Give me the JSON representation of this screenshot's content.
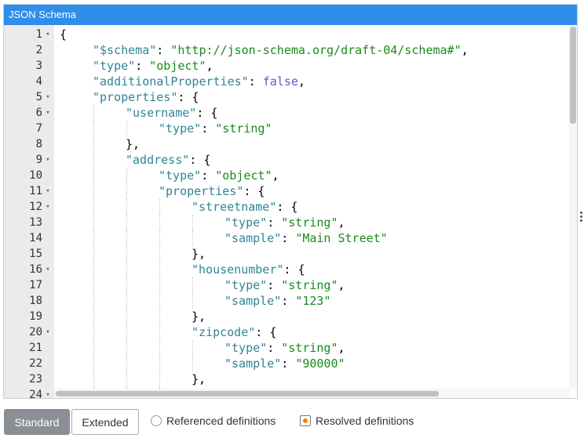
{
  "panel": {
    "title": "JSON Schema"
  },
  "editor": {
    "lines": [
      {
        "n": "1",
        "fold": true,
        "indent": 0,
        "tokens": [
          {
            "t": "{",
            "c": "p"
          }
        ]
      },
      {
        "n": "2",
        "fold": false,
        "indent": 1,
        "tokens": [
          {
            "t": "\"$schema\"",
            "c": "k"
          },
          {
            "t": ": ",
            "c": "p"
          },
          {
            "t": "\"http://json-schema.org/draft-04/schema#\"",
            "c": "s"
          },
          {
            "t": ",",
            "c": "p"
          }
        ]
      },
      {
        "n": "3",
        "fold": false,
        "indent": 1,
        "tokens": [
          {
            "t": "\"type\"",
            "c": "k"
          },
          {
            "t": ": ",
            "c": "p"
          },
          {
            "t": "\"object\"",
            "c": "s"
          },
          {
            "t": ",",
            "c": "p"
          }
        ]
      },
      {
        "n": "4",
        "fold": false,
        "indent": 1,
        "tokens": [
          {
            "t": "\"additionalProperties\"",
            "c": "k"
          },
          {
            "t": ": ",
            "c": "p"
          },
          {
            "t": "false",
            "c": "c"
          },
          {
            "t": ",",
            "c": "p"
          }
        ]
      },
      {
        "n": "5",
        "fold": true,
        "indent": 1,
        "tokens": [
          {
            "t": "\"properties\"",
            "c": "k"
          },
          {
            "t": ": {",
            "c": "p"
          }
        ]
      },
      {
        "n": "6",
        "fold": true,
        "indent": 2,
        "tokens": [
          {
            "t": "\"username\"",
            "c": "k"
          },
          {
            "t": ": {",
            "c": "p"
          }
        ]
      },
      {
        "n": "7",
        "fold": false,
        "indent": 3,
        "tokens": [
          {
            "t": "\"type\"",
            "c": "k"
          },
          {
            "t": ": ",
            "c": "p"
          },
          {
            "t": "\"string\"",
            "c": "s"
          }
        ]
      },
      {
        "n": "8",
        "fold": false,
        "indent": 2,
        "tokens": [
          {
            "t": "},",
            "c": "p"
          }
        ]
      },
      {
        "n": "9",
        "fold": true,
        "indent": 2,
        "tokens": [
          {
            "t": "\"address\"",
            "c": "k"
          },
          {
            "t": ": {",
            "c": "p"
          }
        ]
      },
      {
        "n": "10",
        "fold": false,
        "indent": 3,
        "tokens": [
          {
            "t": "\"type\"",
            "c": "k"
          },
          {
            "t": ": ",
            "c": "p"
          },
          {
            "t": "\"object\"",
            "c": "s"
          },
          {
            "t": ",",
            "c": "p"
          }
        ]
      },
      {
        "n": "11",
        "fold": true,
        "indent": 3,
        "tokens": [
          {
            "t": "\"properties\"",
            "c": "k"
          },
          {
            "t": ": {",
            "c": "p"
          }
        ]
      },
      {
        "n": "12",
        "fold": true,
        "indent": 4,
        "tokens": [
          {
            "t": "\"streetname\"",
            "c": "k"
          },
          {
            "t": ": {",
            "c": "p"
          }
        ]
      },
      {
        "n": "13",
        "fold": false,
        "indent": 5,
        "tokens": [
          {
            "t": "\"type\"",
            "c": "k"
          },
          {
            "t": ": ",
            "c": "p"
          },
          {
            "t": "\"string\"",
            "c": "s"
          },
          {
            "t": ",",
            "c": "p"
          }
        ]
      },
      {
        "n": "14",
        "fold": false,
        "indent": 5,
        "tokens": [
          {
            "t": "\"sample\"",
            "c": "k"
          },
          {
            "t": ": ",
            "c": "p"
          },
          {
            "t": "\"Main Street\"",
            "c": "s"
          }
        ]
      },
      {
        "n": "15",
        "fold": false,
        "indent": 4,
        "tokens": [
          {
            "t": "},",
            "c": "p"
          }
        ]
      },
      {
        "n": "16",
        "fold": true,
        "indent": 4,
        "tokens": [
          {
            "t": "\"housenumber\"",
            "c": "k"
          },
          {
            "t": ": {",
            "c": "p"
          }
        ]
      },
      {
        "n": "17",
        "fold": false,
        "indent": 5,
        "tokens": [
          {
            "t": "\"type\"",
            "c": "k"
          },
          {
            "t": ": ",
            "c": "p"
          },
          {
            "t": "\"string\"",
            "c": "s"
          },
          {
            "t": ",",
            "c": "p"
          }
        ]
      },
      {
        "n": "18",
        "fold": false,
        "indent": 5,
        "tokens": [
          {
            "t": "\"sample\"",
            "c": "k"
          },
          {
            "t": ": ",
            "c": "p"
          },
          {
            "t": "\"123\"",
            "c": "s"
          }
        ]
      },
      {
        "n": "19",
        "fold": false,
        "indent": 4,
        "tokens": [
          {
            "t": "},",
            "c": "p"
          }
        ]
      },
      {
        "n": "20",
        "fold": true,
        "indent": 4,
        "tokens": [
          {
            "t": "\"zipcode\"",
            "c": "k"
          },
          {
            "t": ": {",
            "c": "p"
          }
        ]
      },
      {
        "n": "21",
        "fold": false,
        "indent": 5,
        "tokens": [
          {
            "t": "\"type\"",
            "c": "k"
          },
          {
            "t": ": ",
            "c": "p"
          },
          {
            "t": "\"string\"",
            "c": "s"
          },
          {
            "t": ",",
            "c": "p"
          }
        ]
      },
      {
        "n": "22",
        "fold": false,
        "indent": 5,
        "tokens": [
          {
            "t": "\"sample\"",
            "c": "k"
          },
          {
            "t": ": ",
            "c": "p"
          },
          {
            "t": "\"90000\"",
            "c": "s"
          }
        ]
      },
      {
        "n": "23",
        "fold": false,
        "indent": 4,
        "tokens": [
          {
            "t": "},",
            "c": "p"
          }
        ]
      },
      {
        "n": "24",
        "fold": true,
        "indent": 4,
        "tokens": [
          {
            "t": "",
            "c": "p"
          }
        ]
      }
    ]
  },
  "toolbar": {
    "standard_label": "Standard",
    "extended_label": "Extended",
    "radio_referenced": "Referenced definitions",
    "radio_resolved": "Resolved definitions",
    "selected": "Resolved definitions"
  },
  "colors": {
    "titlebar": "#2f8eea",
    "key": "#318495",
    "string": "#1a8a1a",
    "constant": "#5b5bc1",
    "radio_selected": "#ff7f00"
  }
}
